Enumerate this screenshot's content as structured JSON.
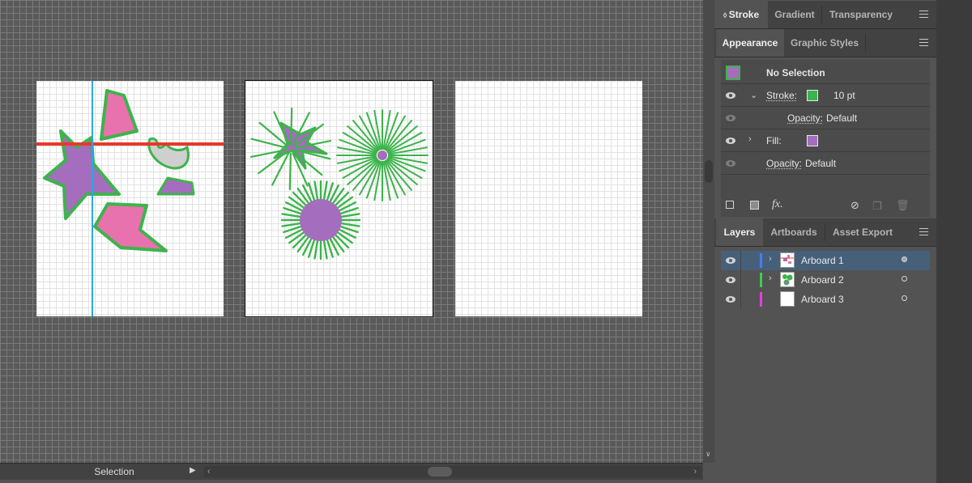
{
  "status_bar": {
    "tool": "Selection"
  },
  "panels": {
    "stroke_group": {
      "tabs": [
        {
          "label": "Stroke",
          "active": true,
          "prefix": "◊"
        },
        {
          "label": "Gradient",
          "active": false
        },
        {
          "label": "Transparency",
          "active": false
        }
      ]
    },
    "appearance_group": {
      "tabs": [
        {
          "label": "Appearance",
          "active": true
        },
        {
          "label": "Graphic Styles",
          "active": false
        }
      ]
    },
    "appearance": {
      "header": "No Selection",
      "stroke_label": "Stroke:",
      "stroke_value": "10 pt",
      "stroke_opacity_label": "Opacity:",
      "stroke_opacity_value": "Default",
      "fill_label": "Fill:",
      "opacity_label": "Opacity:",
      "opacity_value": "Default",
      "stroke_color": "#3cb44b",
      "fill_color": "#a56dbd",
      "fx_label": "fx."
    },
    "layers_group": {
      "tabs": [
        {
          "label": "Layers",
          "active": true
        },
        {
          "label": "Artboards",
          "active": false
        },
        {
          "label": "Asset Export",
          "active": false
        }
      ]
    },
    "layers": [
      {
        "name": "Arboard 1",
        "color": "#4a7cf0",
        "selected": true
      },
      {
        "name": "Arboard 2",
        "color": "#39d04b",
        "selected": false
      },
      {
        "name": "Arboard 3",
        "color": "#e040e0",
        "selected": false
      }
    ]
  },
  "colors": {
    "pink": "#e772ad",
    "purple": "#a56dbd",
    "green": "#3cb44b",
    "red_guide": "#e8382a",
    "blue_guide": "#28a9e0",
    "gray_shape": "#cfcfcf"
  },
  "icons": {
    "visibility": "eye-icon",
    "expand": "chevron-right-icon",
    "collapse": "chevron-down-icon",
    "panel_menu": "hamburger-menu-icon",
    "add_stroke": "square-outline-icon",
    "add_fill": "square-filled-icon",
    "effects": "fx-icon",
    "clear": "no-entry-icon",
    "duplicate": "duplicate-icon",
    "delete": "trash-icon"
  }
}
